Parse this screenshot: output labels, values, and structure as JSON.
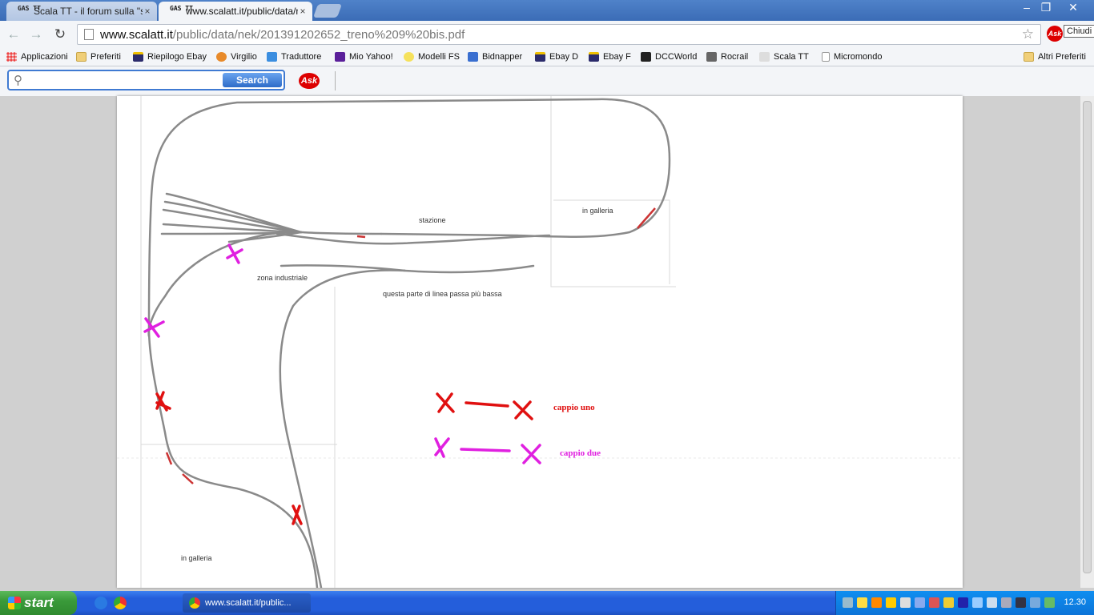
{
  "tabs": [
    {
      "favicon_text": "GAS TT",
      "title": "Scala TT - il forum sulla \"scala",
      "close": "×",
      "active": false
    },
    {
      "favicon_text": "GAS TT",
      "title": "www.scalatt.it/public/data/n",
      "close": "×",
      "active": true
    }
  ],
  "window_controls": {
    "minimize": "–",
    "restore": "❐",
    "close": "✕"
  },
  "toolbar": {
    "back": "←",
    "forward": "→",
    "reload": "↻",
    "url_host": "www.scalatt.it",
    "url_path": "/public/data/nek/201391202652_treno%209%20bis.pdf",
    "star": "☆",
    "ask_button": "Ask",
    "tooltip": "Chiudi"
  },
  "bookmarks": [
    {
      "label": "Applicazioni",
      "icon": "apps-grid-icon"
    },
    {
      "label": "Preferiti",
      "icon": "folder-icon"
    },
    {
      "label": "Riepilogo Ebay",
      "icon": "bag-icon"
    },
    {
      "label": "Virgilio",
      "icon": "virgilio-icon"
    },
    {
      "label": "Traduttore",
      "icon": "translate-icon"
    },
    {
      "label": "Mio Yahoo!",
      "icon": "yahoo-icon"
    },
    {
      "label": "Modelli FS",
      "icon": "fs-icon"
    },
    {
      "label": "Bidnapper",
      "icon": "bidnapper-icon"
    },
    {
      "label": "Ebay D",
      "icon": "bag-icon"
    },
    {
      "label": "Ebay F",
      "icon": "bag-icon"
    },
    {
      "label": "DCCWorld",
      "icon": "dcc-icon"
    },
    {
      "label": "Rocrail",
      "icon": "train-icon"
    },
    {
      "label": "Scala TT",
      "icon": "gas-tt-icon"
    },
    {
      "label": "Micromondo",
      "icon": "page-icon"
    }
  ],
  "other_bookmarks": "Altri Preferiti",
  "ask_toolbar": {
    "search_placeholder": "",
    "search_button": "Search",
    "logo": "Ask"
  },
  "pdf": {
    "labels": {
      "stazione": "stazione",
      "in_galleria_top": "in galleria",
      "zona_industriale": "zona industriale",
      "lower_track_note": "questa parte di linea passa più bassa",
      "in_galleria_bottom": "in galleria"
    },
    "legend": [
      {
        "label": "cappio uno",
        "color": "#e01010"
      },
      {
        "label": "cappio due",
        "color": "#e020e0"
      }
    ]
  },
  "taskbar": {
    "start": "start",
    "task_title": "www.scalatt.it/public...",
    "clock": "12.30"
  },
  "colors": {
    "accent": "#245edb",
    "track": "#8a8a8a",
    "loop_one": "#e01010",
    "loop_two": "#e020e0"
  }
}
